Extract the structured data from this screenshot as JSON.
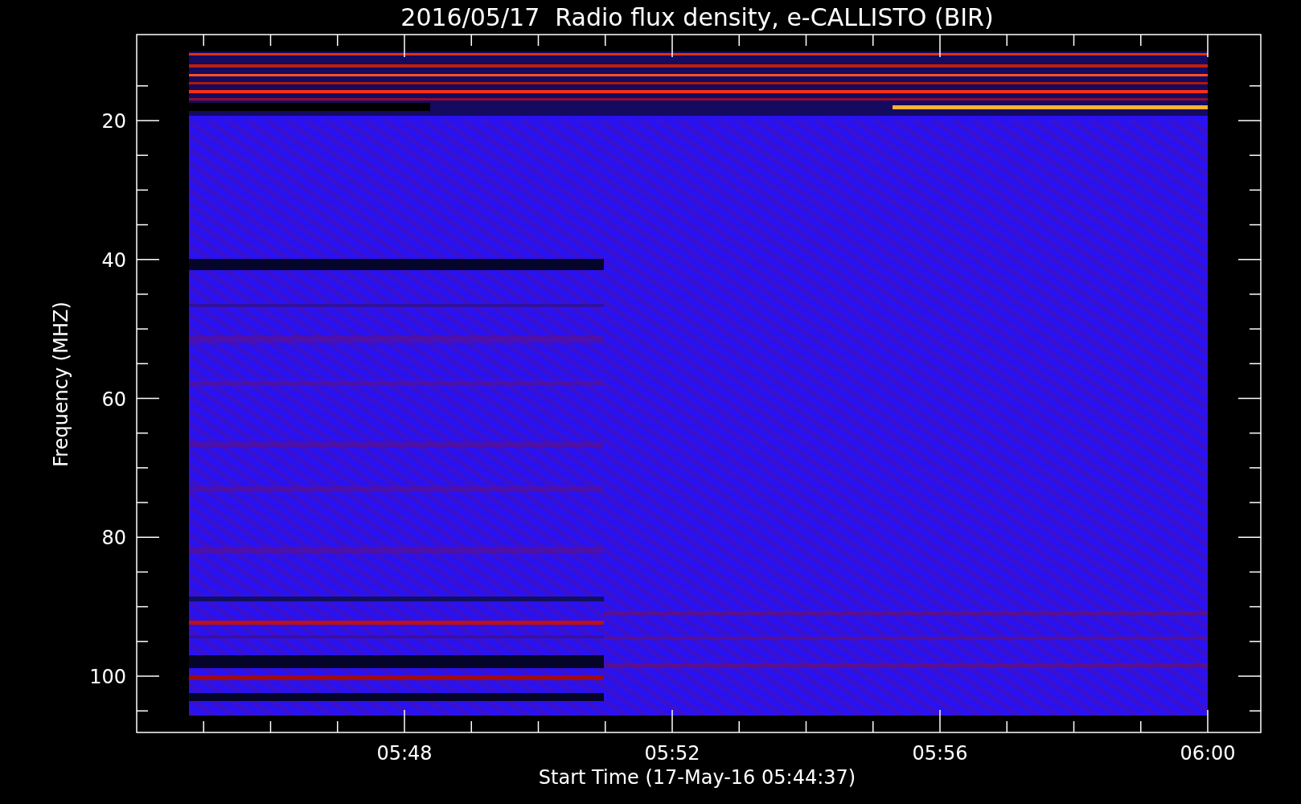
{
  "title": "2016/05/17  Radio flux density, e-CALLISTO (BIR)",
  "y_axis": {
    "label": "Frequency (MHZ)",
    "ticks": [
      "20",
      "40",
      "60",
      "80",
      "100"
    ]
  },
  "x_axis": {
    "label": "Start Time (17-May-16 05:44:37)",
    "ticks": [
      "05:48",
      "05:52",
      "05:56",
      "06:00"
    ]
  }
}
